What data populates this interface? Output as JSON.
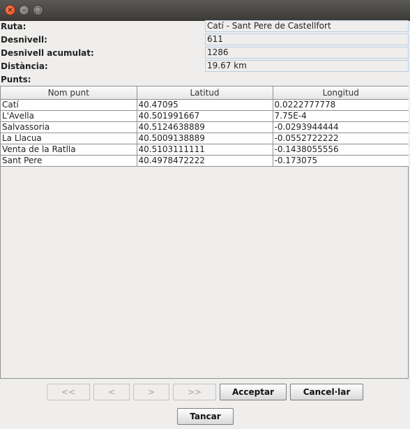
{
  "window": {
    "controls": [
      "close-icon",
      "minimize-icon",
      "maximize-icon"
    ]
  },
  "info": {
    "ruta_label": "Ruta:",
    "ruta_value": "Catí - Sant Pere de Castellfort",
    "desnivell_label": "Desnivell:",
    "desnivell_value": "611",
    "acumulat_label": "Desnivell acumulat:",
    "acumulat_value": "1286",
    "distancia_label": "Distància:",
    "distancia_value": "19.67 km",
    "punts_label": "Punts:"
  },
  "table": {
    "headers": [
      "Nom punt",
      "Latitud",
      "Longitud"
    ],
    "rows": [
      [
        "Catí",
        "40.47095",
        "0.0222777778"
      ],
      [
        "L'Avella",
        "40.501991667",
        "7.75E-4"
      ],
      [
        "Salvassoria",
        "40.5124638889",
        "-0.0293944444"
      ],
      [
        "La Llacua",
        "40.5009138889",
        "-0.0552722222"
      ],
      [
        "Venta de la Ratlla",
        "40.5103111111",
        "-0.1438055556"
      ],
      [
        "Sant Pere",
        "40.4978472222",
        "-0.173075"
      ]
    ]
  },
  "buttons": {
    "first": "<<",
    "prev": "<",
    "next": ">",
    "last": ">>",
    "accept": "Acceptar",
    "cancel": "Cancel·lar",
    "close": "Tancar"
  }
}
